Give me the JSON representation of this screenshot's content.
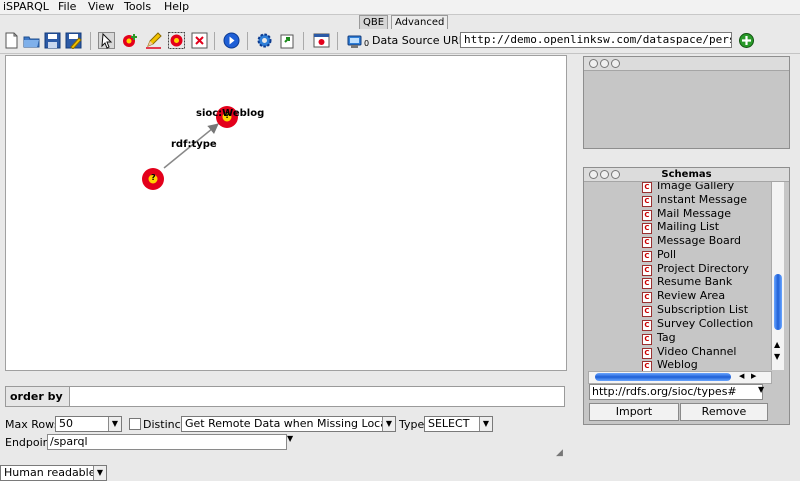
{
  "menu": {
    "app": "iSPARQL",
    "file": "File",
    "view": "View",
    "tools": "Tools",
    "help": "Help"
  },
  "tabs": {
    "qbe": "QBE",
    "advanced": "Advanced"
  },
  "toolbar": {
    "ds_label": "Data Source URI",
    "ds_value": "http://demo.openlinksw.com/dataspace/person/dem",
    "ds_badge": "0"
  },
  "graph": {
    "edge_label": "rdf:type",
    "node_target_label": "sioc:Weblog",
    "node_marker": "?"
  },
  "order_by": {
    "label": "order by"
  },
  "controls": {
    "max_rows_label": "Max Rows",
    "max_rows_value": "50",
    "distinct_label": "Distinct",
    "remote_value": "Get Remote Data when Missing Locally",
    "type_label": "Type",
    "type_value": "SELECT",
    "endpoint_label": "Endpoint",
    "endpoint_value": "/sparql",
    "format_value": "Human readable"
  },
  "schemas": {
    "title": "Schemas",
    "items": [
      "Image Gallery",
      "Instant Message",
      "Mail Message",
      "Mailing List",
      "Message Board",
      "Poll",
      "Project Directory",
      "Resume Bank",
      "Review Area",
      "Subscription List",
      "Survey Collection",
      "Tag",
      "Video Channel",
      "Weblog"
    ],
    "url_value": "http://rdfs.org/sioc/types#",
    "import_label": "Import",
    "remove_label": "Remove"
  },
  "colors": {
    "node_fill": "#e3001b",
    "node_center": "#ffd400",
    "accent": "#1e5fd6"
  }
}
